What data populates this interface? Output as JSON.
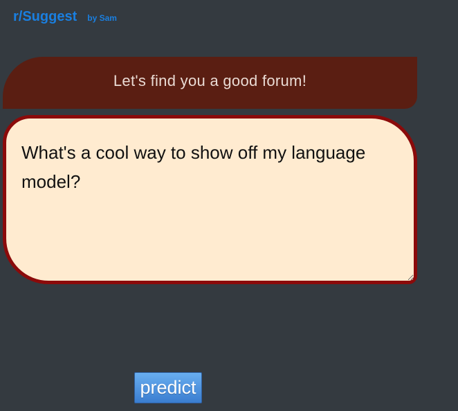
{
  "header": {
    "brand": "r/Suggest",
    "byline": "by Sam"
  },
  "banner": {
    "text": "Let's find you a good forum!"
  },
  "query": {
    "value": "What's a cool way to show off my language model?"
  },
  "predict_button": {
    "label": "predict"
  },
  "colors": {
    "page_background": "#343a40",
    "brand_blue": "#1a7fe0",
    "banner_background": "#5a1e12",
    "textarea_background": "#ffebd0",
    "textarea_border": "#8b0a0a",
    "button_blue": "#4a8ee0"
  }
}
